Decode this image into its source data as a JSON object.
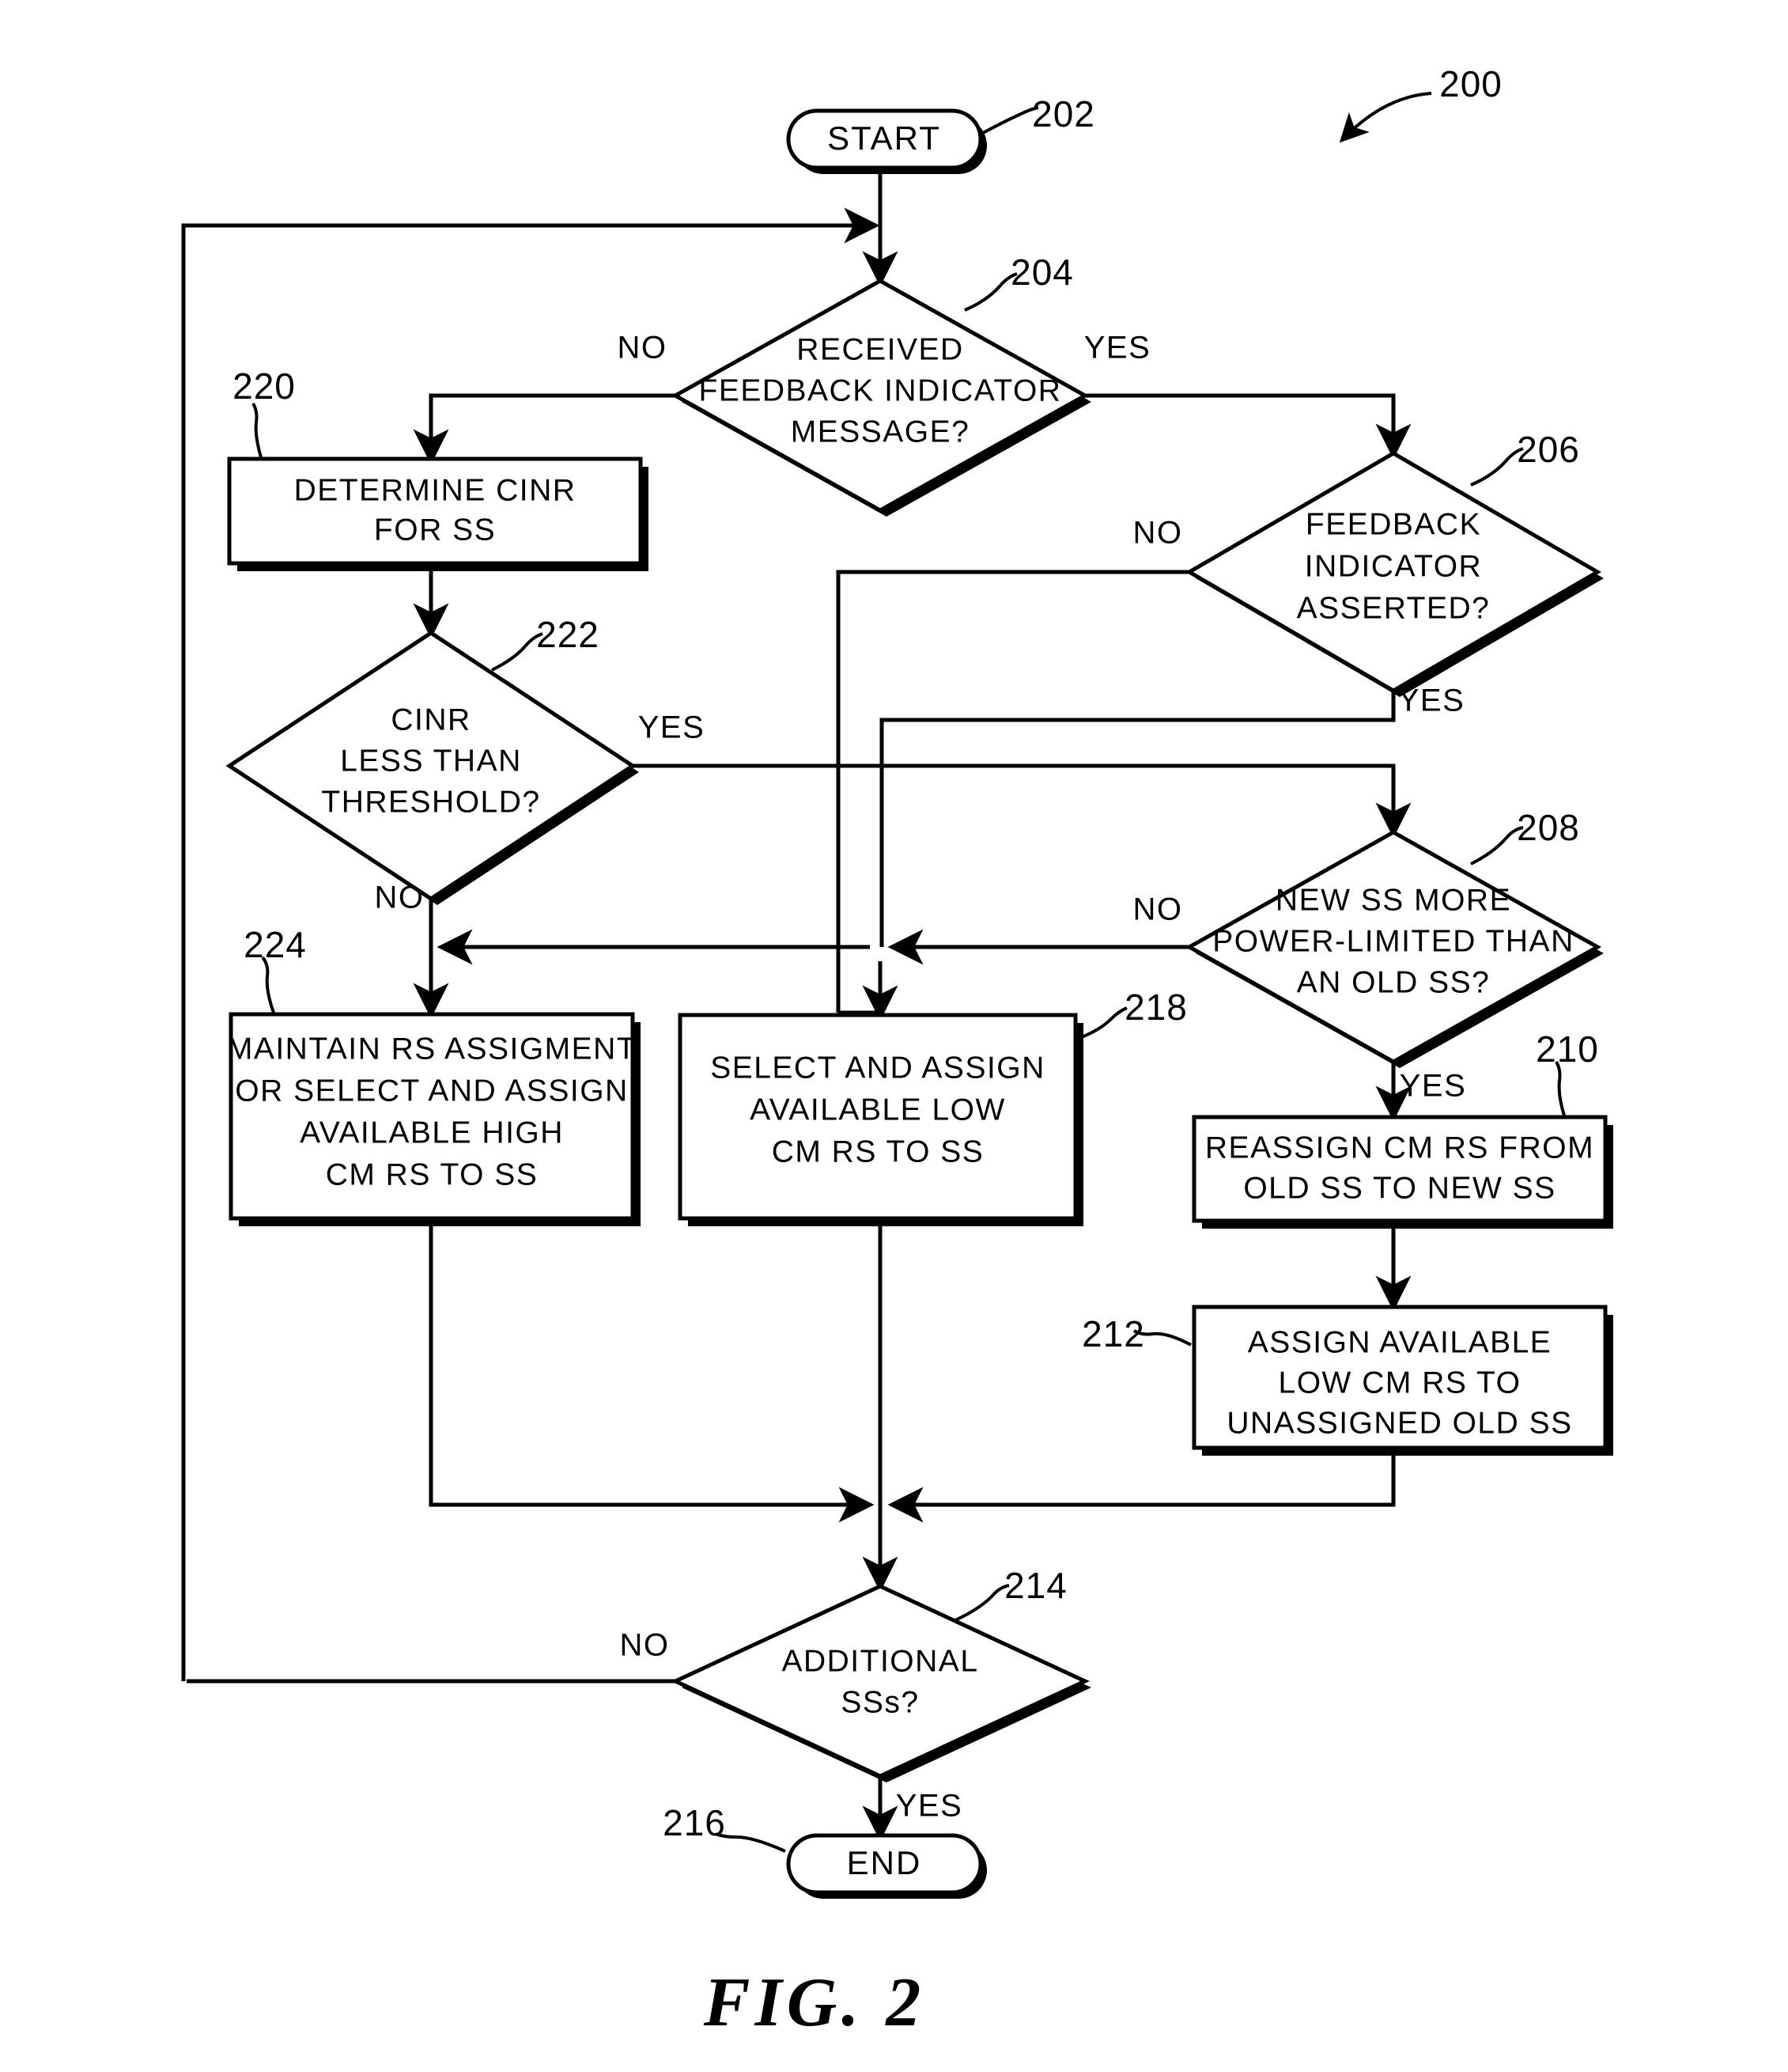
{
  "figure": {
    "caption": "FIG. 2",
    "diagram_ref": "200"
  },
  "nodes": {
    "start": {
      "ref": "202",
      "label": "START",
      "shape": "terminator"
    },
    "d204": {
      "ref": "204",
      "shape": "decision",
      "lines": [
        "RECEIVED",
        "FEEDBACK INDICATOR",
        "MESSAGE?"
      ]
    },
    "p220": {
      "ref": "220",
      "shape": "process",
      "lines": [
        "DETERMINE CINR",
        "FOR SS"
      ]
    },
    "d222": {
      "ref": "222",
      "shape": "decision",
      "lines": [
        "CINR",
        "LESS THAN",
        "THRESHOLD?"
      ]
    },
    "p224": {
      "ref": "224",
      "shape": "process",
      "lines": [
        "MAINTAIN RS ASSIGMENT",
        "OR SELECT AND ASSIGN",
        "AVAILABLE HIGH",
        "CM RS TO SS"
      ]
    },
    "p218": {
      "ref": "218",
      "shape": "process",
      "lines": [
        "SELECT AND ASSIGN",
        "AVAILABLE LOW",
        "CM RS TO SS"
      ]
    },
    "d206": {
      "ref": "206",
      "shape": "decision",
      "lines": [
        "FEEDBACK",
        "INDICATOR",
        "ASSERTED?"
      ]
    },
    "d208": {
      "ref": "208",
      "shape": "decision",
      "lines": [
        "NEW SS MORE",
        "POWER-LIMITED THAN",
        "AN OLD SS?"
      ]
    },
    "p210": {
      "ref": "210",
      "shape": "process",
      "lines": [
        "REASSIGN CM RS FROM",
        "OLD SS TO NEW SS"
      ]
    },
    "p212": {
      "ref": "212",
      "shape": "process",
      "lines": [
        "ASSIGN AVAILABLE",
        "LOW CM RS TO",
        "UNASSIGNED OLD SS"
      ]
    },
    "d214": {
      "ref": "214",
      "shape": "decision",
      "lines": [
        "ADDITIONAL",
        "SSs?"
      ]
    },
    "end": {
      "ref": "216",
      "label": "END",
      "shape": "terminator"
    }
  },
  "branch_labels": {
    "d204_no": "NO",
    "d204_yes": "YES",
    "d206_no": "NO",
    "d206_yes": "YES",
    "d222_yes": "YES",
    "d222_no": "NO",
    "d208_no": "NO",
    "d208_yes": "YES",
    "d214_no": "NO",
    "d214_yes": "YES"
  },
  "style": {
    "ink": "#000000",
    "paper": "#ffffff"
  }
}
